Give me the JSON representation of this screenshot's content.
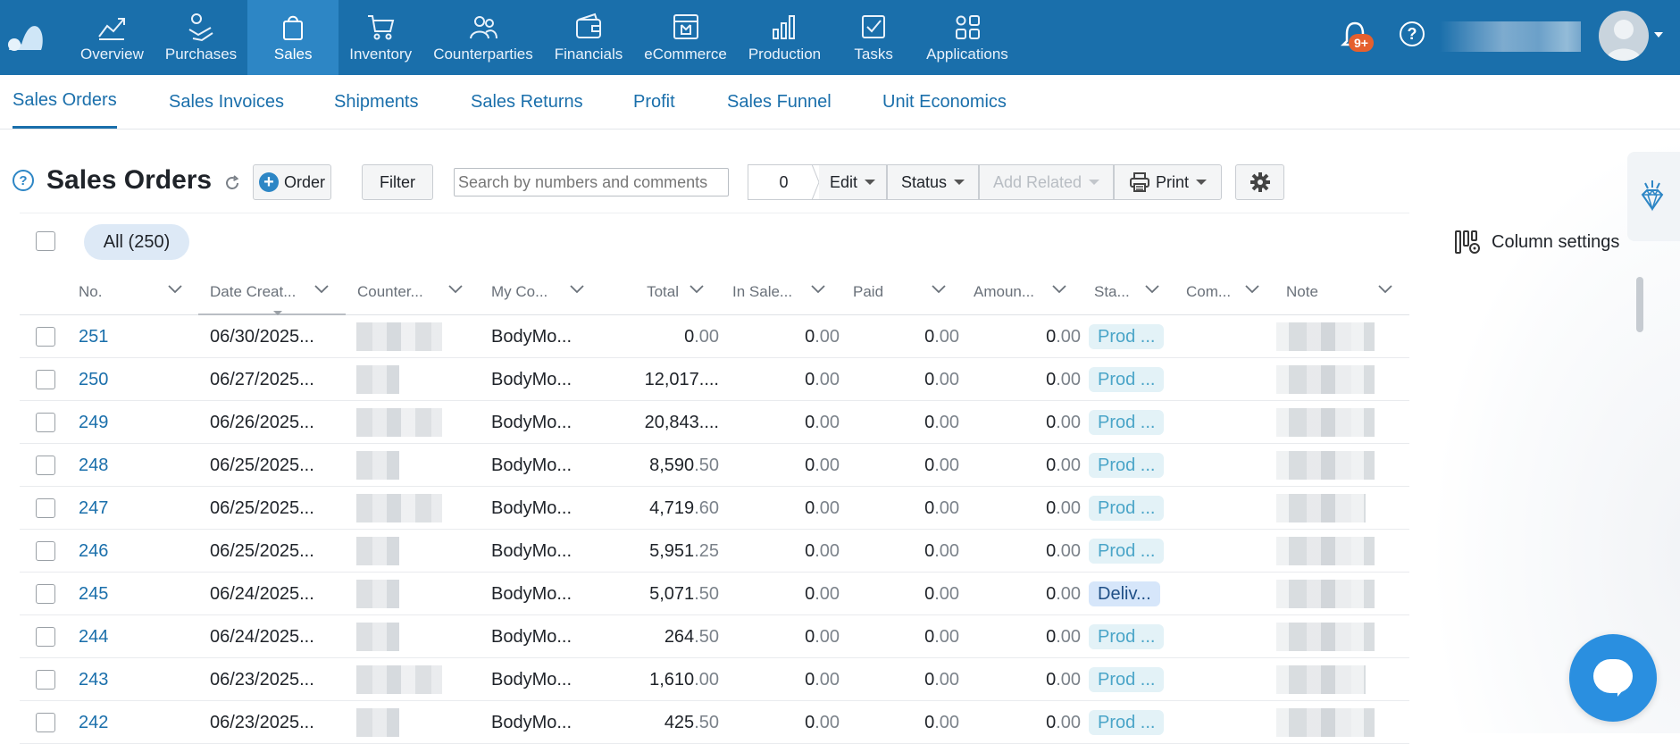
{
  "nav": {
    "items": [
      {
        "label": "Overview",
        "icon": "chart-line-icon"
      },
      {
        "label": "Purchases",
        "icon": "hand-coins-icon"
      },
      {
        "label": "Sales",
        "icon": "shopping-bag-icon"
      },
      {
        "label": "Inventory",
        "icon": "cart-icon"
      },
      {
        "label": "Counterparties",
        "icon": "people-icon"
      },
      {
        "label": "Financials",
        "icon": "wallet-icon"
      },
      {
        "label": "eCommerce",
        "icon": "storefront-icon"
      },
      {
        "label": "Production",
        "icon": "bar-chart-icon"
      },
      {
        "label": "Tasks",
        "icon": "checkbox-icon"
      },
      {
        "label": "Applications",
        "icon": "apps-grid-icon"
      }
    ],
    "active": "Sales",
    "notification_badge": "9+"
  },
  "subnav": {
    "tabs": [
      {
        "label": "Sales Orders"
      },
      {
        "label": "Sales Invoices"
      },
      {
        "label": "Shipments"
      },
      {
        "label": "Sales Returns"
      },
      {
        "label": "Profit"
      },
      {
        "label": "Sales Funnel"
      },
      {
        "label": "Unit Economics"
      }
    ],
    "active": "Sales Orders"
  },
  "toolbar": {
    "help": "?",
    "title": "Sales Orders",
    "order_label": "Order",
    "filter_label": "Filter",
    "search_placeholder": "Search by numbers and comments",
    "selected_count": "0",
    "edit_label": "Edit",
    "status_label": "Status",
    "add_related_label": "Add Related",
    "print_label": "Print"
  },
  "table": {
    "filter_chip": "All (250)",
    "column_settings_label": "Column settings",
    "columns": [
      "No.",
      "Date Creat...",
      "Counter...",
      "My Co...",
      "Total",
      "In Sale...",
      "Paid",
      "Amoun...",
      "Sta...",
      "Com...",
      "Note"
    ],
    "rows": [
      {
        "no": "251",
        "date": "06/30/2025...",
        "company": "BodyMo...",
        "total_int": "0",
        "total_dec": ".00",
        "in_sale": "0",
        "paid": "0",
        "amount": "0",
        "status": "Prod ...",
        "status_type": "prod"
      },
      {
        "no": "250",
        "date": "06/27/2025...",
        "company": "BodyMo...",
        "total_int": "12,017....",
        "total_dec": "",
        "in_sale": "0",
        "paid": "0",
        "amount": "0",
        "status": "Prod ...",
        "status_type": "prod"
      },
      {
        "no": "249",
        "date": "06/26/2025...",
        "company": "BodyMo...",
        "total_int": "20,843....",
        "total_dec": "",
        "in_sale": "0",
        "paid": "0",
        "amount": "0",
        "status": "Prod ...",
        "status_type": "prod"
      },
      {
        "no": "248",
        "date": "06/25/2025...",
        "company": "BodyMo...",
        "total_int": "8,590",
        "total_dec": ".50",
        "in_sale": "0",
        "paid": "0",
        "amount": "0",
        "status": "Prod ...",
        "status_type": "prod"
      },
      {
        "no": "247",
        "date": "06/25/2025...",
        "company": "BodyMo...",
        "total_int": "4,719",
        "total_dec": ".60",
        "in_sale": "0",
        "paid": "0",
        "amount": "0",
        "status": "Prod ...",
        "status_type": "prod"
      },
      {
        "no": "246",
        "date": "06/25/2025...",
        "company": "BodyMo...",
        "total_int": "5,951",
        "total_dec": ".25",
        "in_sale": "0",
        "paid": "0",
        "amount": "0",
        "status": "Prod ...",
        "status_type": "prod"
      },
      {
        "no": "245",
        "date": "06/24/2025...",
        "company": "BodyMo...",
        "total_int": "5,071",
        "total_dec": ".50",
        "in_sale": "0",
        "paid": "0",
        "amount": "0",
        "status": "Deliv...",
        "status_type": "deliv"
      },
      {
        "no": "244",
        "date": "06/24/2025...",
        "company": "BodyMo...",
        "total_int": "264",
        "total_dec": ".50",
        "in_sale": "0",
        "paid": "0",
        "amount": "0",
        "status": "Prod ...",
        "status_type": "prod"
      },
      {
        "no": "243",
        "date": "06/23/2025...",
        "company": "BodyMo...",
        "total_int": "1,610",
        "total_dec": ".00",
        "in_sale": "0",
        "paid": "0",
        "amount": "0",
        "status": "Prod ...",
        "status_type": "prod"
      },
      {
        "no": "242",
        "date": "06/23/2025...",
        "company": "BodyMo...",
        "total_int": "425",
        "total_dec": ".50",
        "in_sale": "0",
        "paid": "0",
        "amount": "0",
        "status": "Prod ...",
        "status_type": "prod"
      }
    ],
    "zero_dec": ".00"
  },
  "colors": {
    "topbar": "#1a6fab",
    "active_nav": "#2d86c5",
    "link": "#1a6fab",
    "status_prod_bg": "#e3f2f7",
    "status_prod_text": "#4aa5c8",
    "status_deliv_bg": "#d6e6fa",
    "status_deliv_text": "#1f4f86",
    "chat": "#2a8fe0"
  }
}
